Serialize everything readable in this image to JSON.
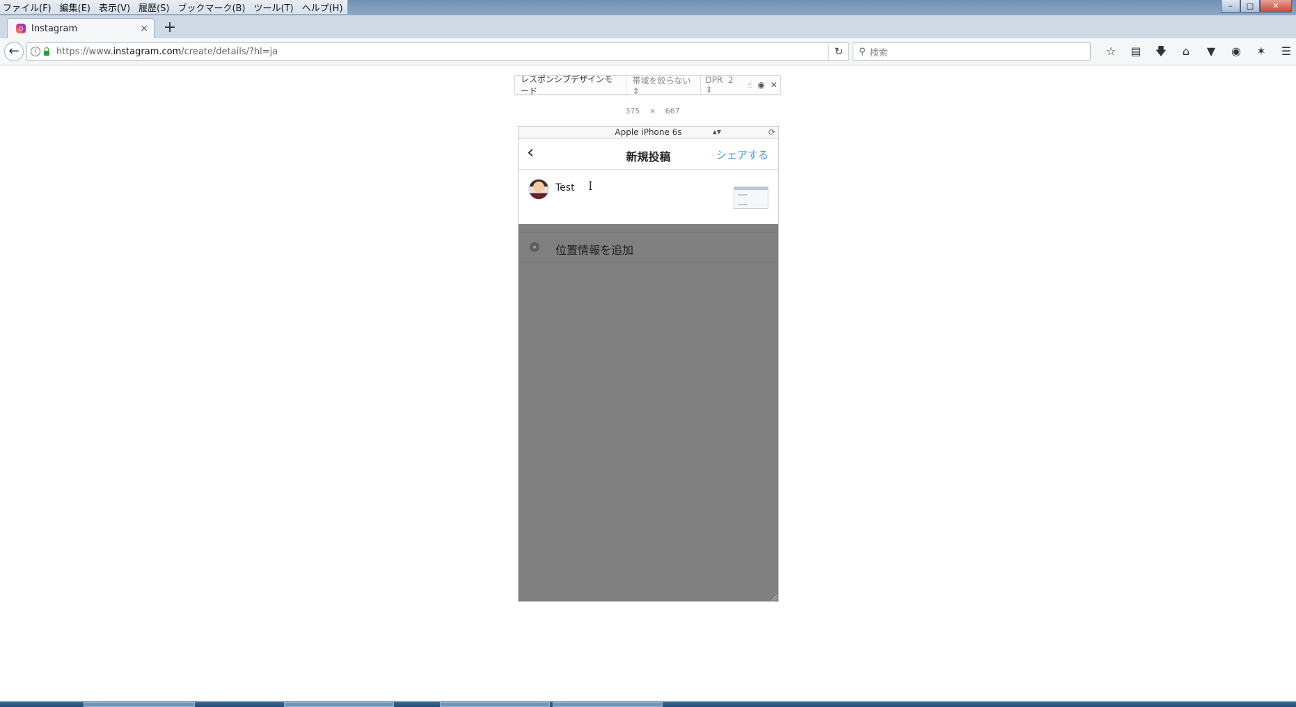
{
  "browser": {
    "menu": [
      "ファイル(F)",
      "編集(E)",
      "表示(V)",
      "履歴(S)",
      "ブックマーク(B)",
      "ツール(T)",
      "ヘルプ(H)"
    ],
    "tab": {
      "title": "Instagram",
      "close": "×"
    },
    "new_tab": "+",
    "url": {
      "prefix": "https://www.",
      "domain": "instagram.com",
      "path": "/create/details/?hl=ja"
    },
    "search_placeholder": "検索",
    "toolbar_icons": [
      "star-icon",
      "reading-list-icon",
      "download-icon",
      "home-icon",
      "pocket-icon",
      "extension-icon",
      "share-icon",
      "menu-icon"
    ]
  },
  "rdm": {
    "title": "レスポンシブデザインモード",
    "throttle": "帯域を絞らない",
    "dpr_label": "DPR",
    "dpr_value": "2",
    "width": "375",
    "times": "×",
    "height": "667",
    "device": "Apple iPhone 6s"
  },
  "instagram": {
    "title": "新規投稿",
    "share": "シェアする",
    "caption": "Test",
    "location_label": "位置情報を追加",
    "accent_color": "#3897f0",
    "overlay_color": "#808080"
  }
}
